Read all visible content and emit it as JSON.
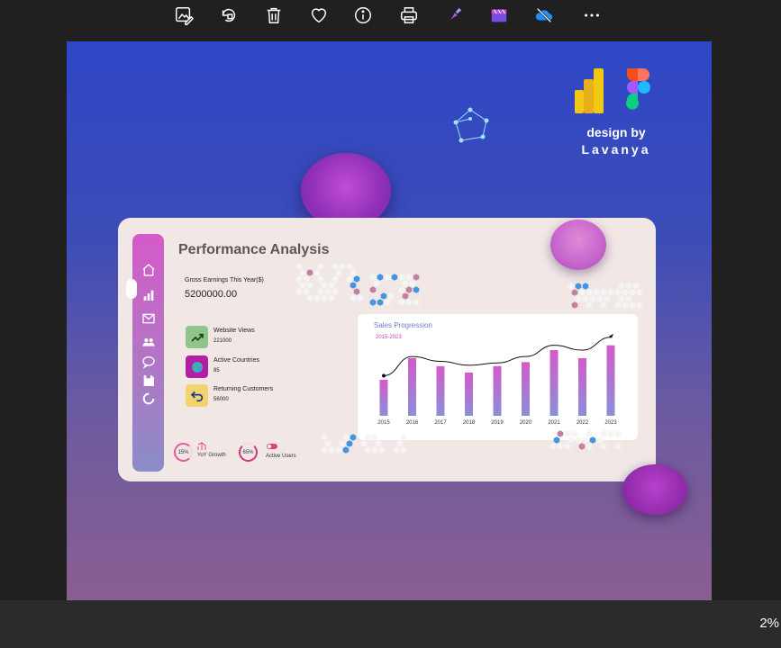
{
  "toolbar": {
    "buttons": [
      {
        "name": "edit-image-button",
        "icon": "edit-image-icon"
      },
      {
        "name": "rotate-button",
        "icon": "rotate-icon"
      },
      {
        "name": "delete-button",
        "icon": "trash-icon"
      },
      {
        "name": "favorite-button",
        "icon": "heart-icon"
      },
      {
        "name": "info-button",
        "icon": "info-icon"
      },
      {
        "name": "print-button",
        "icon": "printer-icon"
      },
      {
        "name": "designer-button",
        "icon": "designer-icon"
      },
      {
        "name": "clipchamp-button",
        "icon": "clipchamp-icon"
      },
      {
        "name": "onedrive-button",
        "icon": "cloud-off-icon"
      },
      {
        "name": "more-button",
        "icon": "ellipsis-icon"
      }
    ]
  },
  "status": {
    "zoom": "2%"
  },
  "image": {
    "credit_line1": "design by",
    "credit_line2": "Lavanya",
    "title": "Performance Analysis",
    "gross_label": "Gross Earnings This Year($)",
    "gross_value": "5200000.00",
    "kpis": [
      {
        "label": "Website Views",
        "value": "221000",
        "color": "#8fc58a",
        "icon": "trend-up-icon"
      },
      {
        "label": "Active Countries",
        "value": "85",
        "color": "#b31fa3",
        "icon": "globe-icon"
      },
      {
        "label": "Returning Customers",
        "value": "56000",
        "color": "#f2d36d",
        "icon": "return-arrow-icon"
      }
    ],
    "footer": {
      "yoy_pct": "15%",
      "yoy_label": "YoY Growth",
      "users_pct": "65%",
      "users_label": "Active Users"
    },
    "nav_icons": [
      "home-icon",
      "bar-chart-icon",
      "mail-icon",
      "users-icon",
      "chat-icon",
      "save-icon",
      "spinner-icon"
    ],
    "colors": {
      "accent": "#d136b8",
      "nav_top": "#d45ac8",
      "nav_bottom": "#8b8cc8"
    }
  },
  "chart_data": {
    "type": "bar",
    "title": "Sales Progression",
    "subtitle": "2015-2023",
    "categories": [
      "2015",
      "2016",
      "2017",
      "2018",
      "2019",
      "2020",
      "2021",
      "2022",
      "2023"
    ],
    "values": [
      45,
      72,
      62,
      54,
      62,
      67,
      82,
      72,
      88
    ],
    "line_values": [
      50,
      74,
      68,
      63,
      66,
      74,
      88,
      82,
      98
    ],
    "ylim": [
      0,
      100
    ],
    "grid": false
  }
}
